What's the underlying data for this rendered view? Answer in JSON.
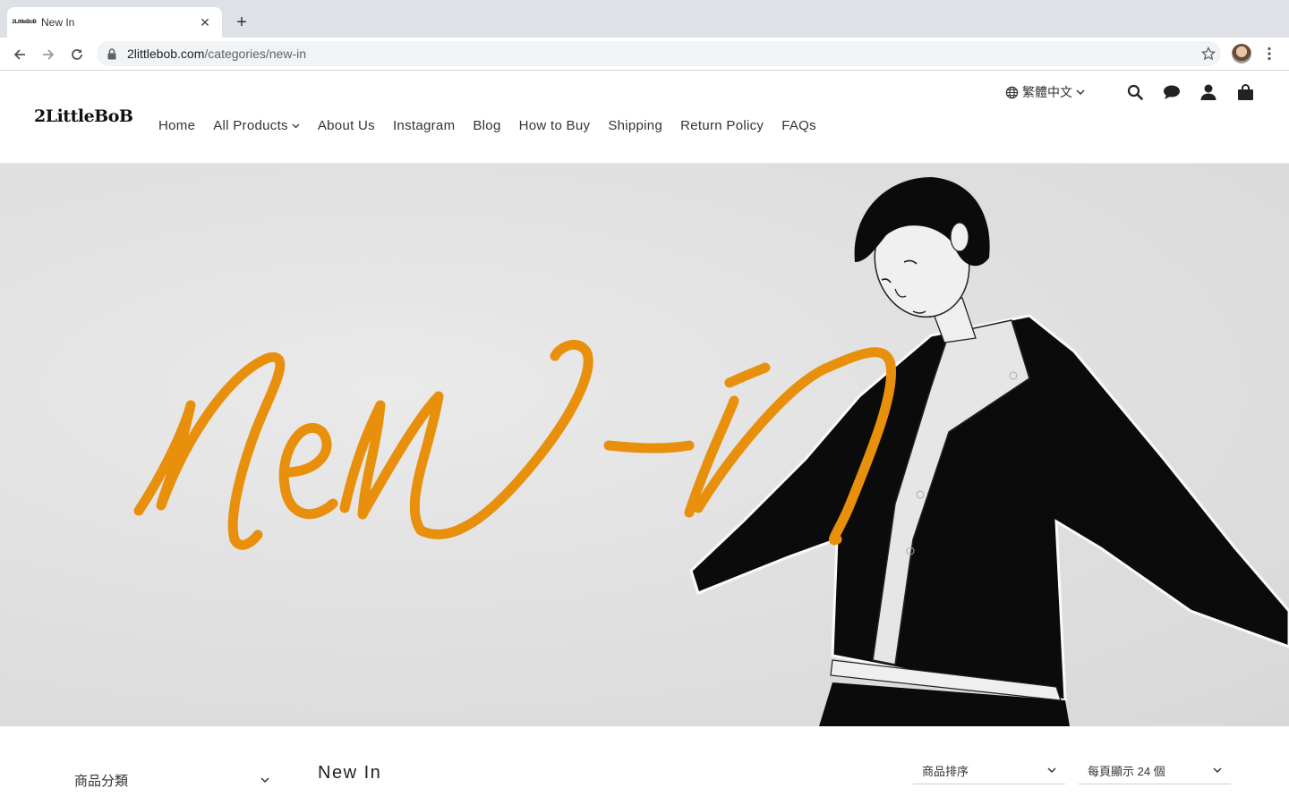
{
  "browser": {
    "tab_title": "New In",
    "tab_favicon_text": "2LittleBoB",
    "url_domain": "2littlebob.com",
    "url_path": "/categories/new-in"
  },
  "header": {
    "logo": "2LittleBoB",
    "nav": [
      "Home",
      "All Products",
      "About Us",
      "Instagram",
      "Blog",
      "How to Buy",
      "Shipping",
      "Return Policy",
      "FAQs"
    ],
    "language": "繁體中文",
    "icons": [
      "search-icon",
      "chat-icon",
      "account-icon",
      "cart-icon"
    ]
  },
  "hero": {
    "script_text": "new-in",
    "accent_color": "#e8900c"
  },
  "listing": {
    "category_label": "商品分類",
    "title": "New In",
    "sort_label": "商品排序",
    "per_page_label": "每頁顯示 24 個"
  }
}
